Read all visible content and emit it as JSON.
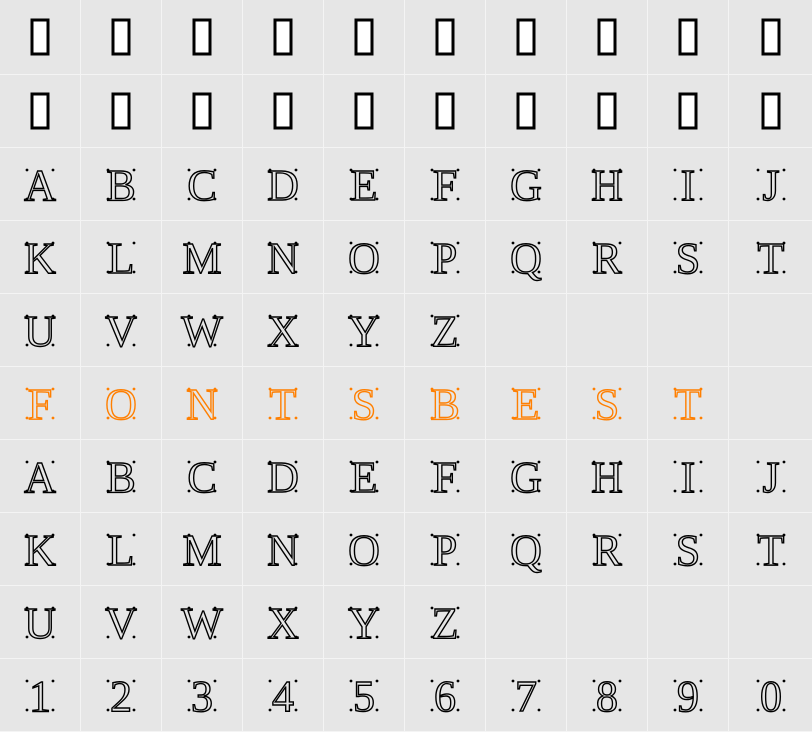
{
  "colors": {
    "background": "#e6e6e6",
    "divider": "#f4f4f4",
    "glyph": "#000000",
    "accent": "#ff7f00"
  },
  "rows": [
    {
      "kind": "tofu",
      "color": "#000000",
      "cells": [
        "",
        "",
        "",
        "",
        "",
        "",
        "",
        "",
        "",
        ""
      ]
    },
    {
      "kind": "tofu",
      "color": "#000000",
      "cells": [
        "",
        "",
        "",
        "",
        "",
        "",
        "",
        "",
        "",
        ""
      ]
    },
    {
      "kind": "glyph",
      "color": "#000000",
      "cells": [
        "A",
        "B",
        "C",
        "D",
        "E",
        "F",
        "G",
        "H",
        "I",
        "J"
      ]
    },
    {
      "kind": "glyph",
      "color": "#000000",
      "cells": [
        "K",
        "L",
        "M",
        "N",
        "O",
        "P",
        "Q",
        "R",
        "S",
        "T"
      ]
    },
    {
      "kind": "glyph",
      "color": "#000000",
      "cells": [
        "U",
        "V",
        "W",
        "X",
        "Y",
        "Z",
        "",
        "",
        "",
        ""
      ]
    },
    {
      "kind": "glyph",
      "color": "#ff7f00",
      "cells": [
        "F",
        "O",
        "N",
        "T",
        "S",
        "B",
        "E",
        "S",
        "T",
        ""
      ]
    },
    {
      "kind": "glyph",
      "color": "#000000",
      "cells": [
        "A",
        "B",
        "C",
        "D",
        "E",
        "F",
        "G",
        "H",
        "I",
        "J"
      ]
    },
    {
      "kind": "glyph",
      "color": "#000000",
      "cells": [
        "K",
        "L",
        "M",
        "N",
        "O",
        "P",
        "Q",
        "R",
        "S",
        "T"
      ]
    },
    {
      "kind": "glyph",
      "color": "#000000",
      "cells": [
        "U",
        "V",
        "W",
        "X",
        "Y",
        "Z",
        "",
        "",
        "",
        ""
      ]
    },
    {
      "kind": "glyph",
      "color": "#000000",
      "cells": [
        "1",
        "2",
        "3",
        "4",
        "5",
        "6",
        "7",
        "8",
        "9",
        "0"
      ]
    }
  ]
}
